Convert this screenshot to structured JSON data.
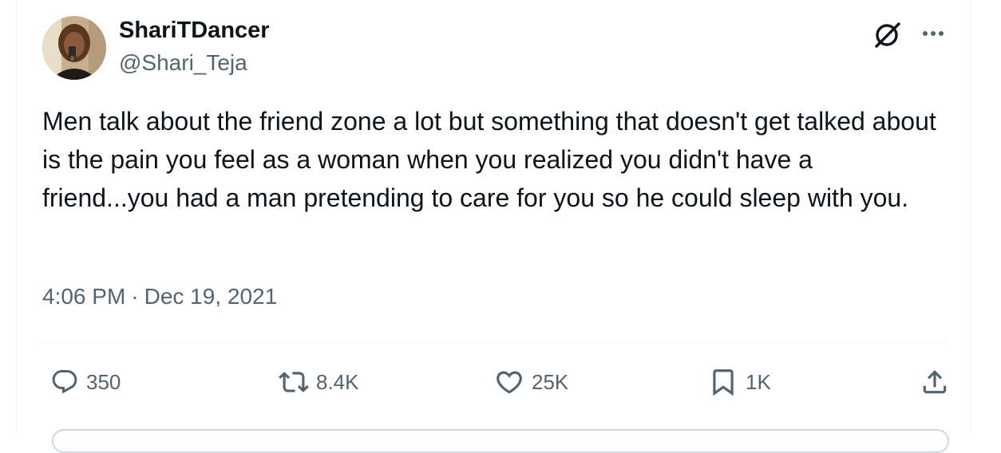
{
  "author": {
    "display_name": "ShariTDancer",
    "handle": "@Shari_Teja"
  },
  "tweet": {
    "text": "Men talk about the friend zone a lot but something that doesn't get talked about is the pain you feel as a woman when you realized you didn't have a friend...you had a man pretending to care for you so he could sleep with you.",
    "time": "4:06 PM",
    "separator": "·",
    "date": "Dec 19, 2021"
  },
  "actions": {
    "reply_count": "350",
    "repost_count": "8.4K",
    "like_count": "25K",
    "bookmark_count": "1K"
  },
  "icons": {
    "top_right": [
      "grok-icon",
      "more-icon"
    ],
    "actions": [
      "reply-icon",
      "repost-icon",
      "like-icon",
      "bookmark-icon",
      "share-icon"
    ]
  },
  "colors": {
    "text_primary": "#0f1419",
    "text_secondary": "#536471",
    "divider": "#eff3f4"
  }
}
